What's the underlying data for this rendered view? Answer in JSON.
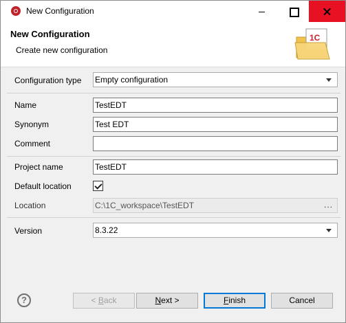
{
  "window": {
    "title": "New Configuration"
  },
  "banner": {
    "title": "New Configuration",
    "subtitle": "Create new configuration",
    "icon_badge": "1C"
  },
  "form": {
    "config_type": {
      "label": "Configuration type",
      "value": "Empty configuration"
    },
    "name": {
      "label": "Name",
      "value": "TestEDT"
    },
    "synonym": {
      "label": "Synonym",
      "value": "Test EDT"
    },
    "comment": {
      "label": "Comment",
      "value": ""
    },
    "project_name": {
      "label": "Project name",
      "value": "TestEDT"
    },
    "default_location": {
      "label": "Default location",
      "checked": true
    },
    "location": {
      "label": "Location",
      "value": "C:\\1C_workspace\\TestEDT",
      "browse": "..."
    },
    "version": {
      "label": "Version",
      "value": "8.3.22"
    }
  },
  "buttons": {
    "help": "?",
    "back": {
      "prefix": "< ",
      "mnemonic": "B",
      "rest": "ack"
    },
    "next": {
      "mnemonic": "N",
      "rest": "ext >"
    },
    "finish": {
      "mnemonic": "F",
      "rest": "inish"
    },
    "cancel": "Cancel"
  },
  "colors": {
    "close_button": "#e81123",
    "app_icon": "#c0232c",
    "default_button_border": "#0078d7"
  }
}
